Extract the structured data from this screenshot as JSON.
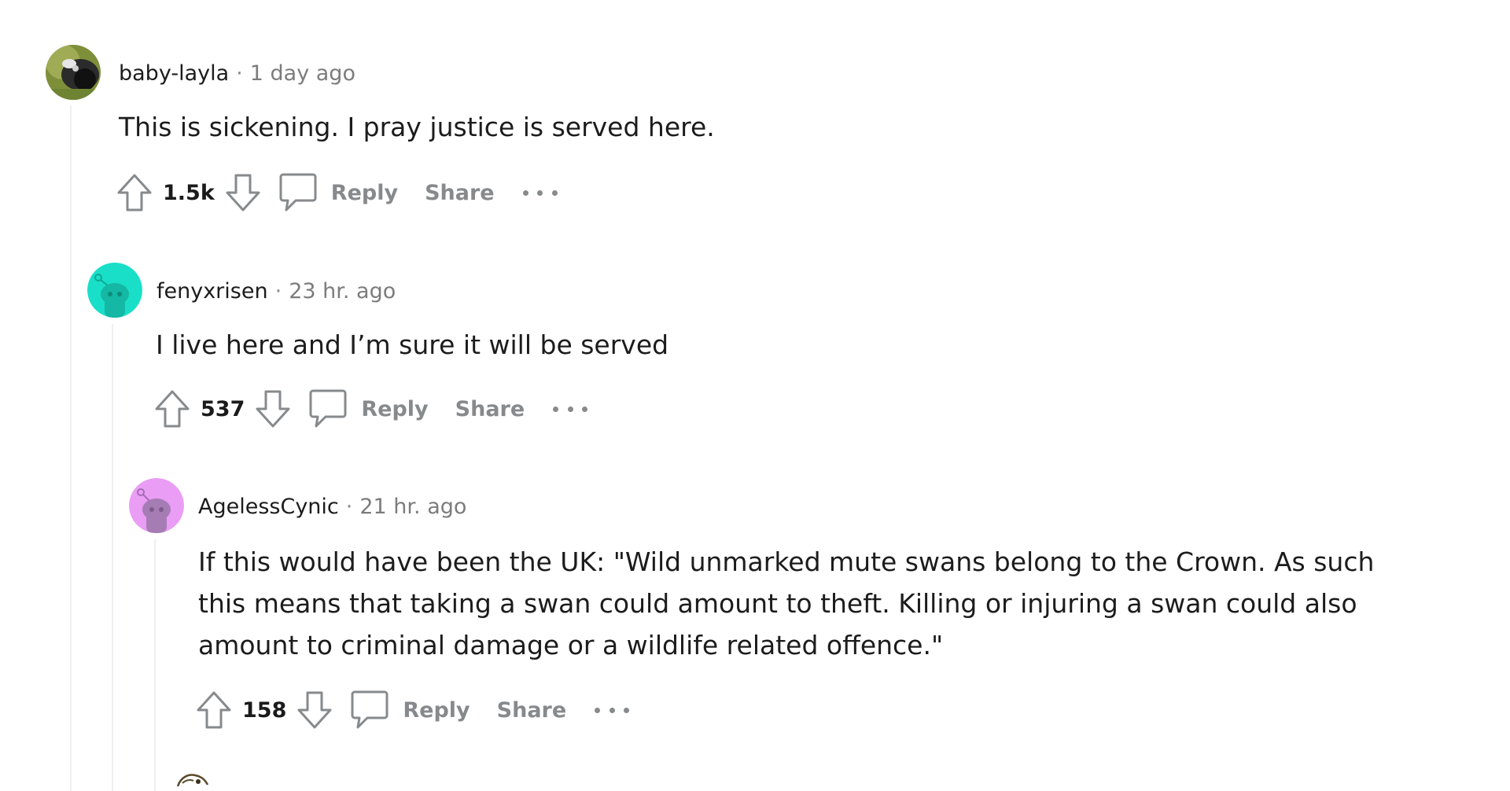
{
  "comments": [
    {
      "author": "baby-layla",
      "separator": "·",
      "time": "1 day ago",
      "body": "This is sickening. I pray justice is served here.",
      "score": "1.5k",
      "reply_label": "Reply",
      "share_label": "Share",
      "avatar_icon": "user-avatar-photo-icon"
    },
    {
      "author": "fenyxrisen",
      "separator": "·",
      "time": "23 hr. ago",
      "body": "I live here and I’m sure it will be served",
      "score": "537",
      "reply_label": "Reply",
      "share_label": "Share",
      "avatar_icon": "snoo-avatar-icon",
      "avatar_color": "#1adfc8"
    },
    {
      "author": "AgelessCynic",
      "separator": "·",
      "time": "21 hr. ago",
      "body_lines": [
        "If this would have been the UK: \"Wild unmarked mute swans belong to the Crown. As such",
        "this means that taking a swan could amount to theft. Killing or injuring a swan could also",
        "amount to criminal damage or a wildlife related offence.\""
      ],
      "score": "158",
      "reply_label": "Reply",
      "share_label": "Share",
      "avatar_icon": "snoo-avatar-icon",
      "avatar_color": "#e99df5"
    }
  ],
  "colors": {
    "text": "#1c1c1c",
    "meta": "#7c7c7c",
    "action": "#878a8c",
    "thread_line": "#edeff1"
  }
}
